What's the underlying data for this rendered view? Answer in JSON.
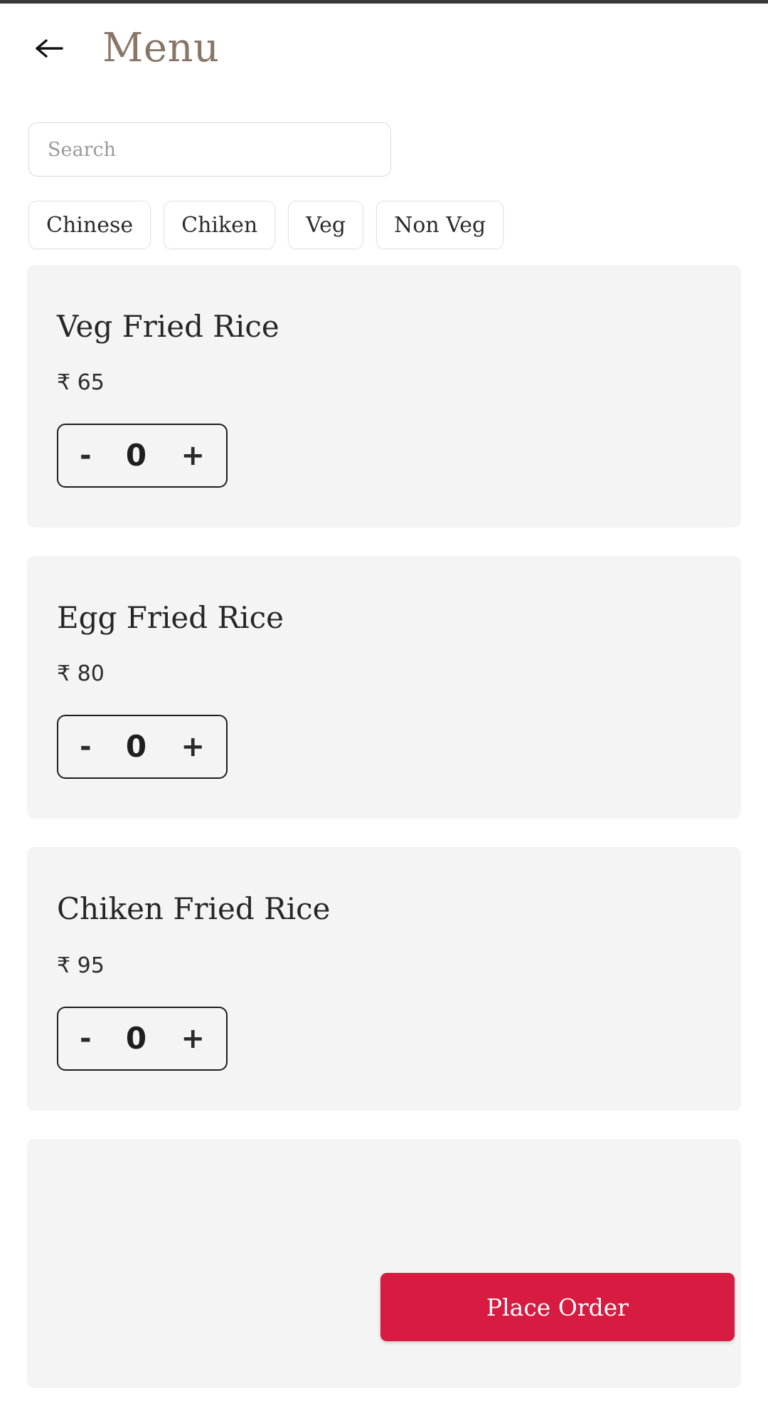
{
  "header": {
    "back_icon": "arrow-left-icon",
    "title": "Menu",
    "title_color": "#8a7668"
  },
  "search": {
    "placeholder": "Search",
    "value": ""
  },
  "filters": [
    {
      "label": "Chinese"
    },
    {
      "label": "Chiken"
    },
    {
      "label": "Veg"
    },
    {
      "label": "Non Veg"
    }
  ],
  "menu_items": [
    {
      "name": "Veg Fried Rice",
      "price": "₹ 65",
      "decrement_label": "-",
      "quantity": "0",
      "increment_label": "+"
    },
    {
      "name": "Egg Fried Rice",
      "price": "₹ 80",
      "decrement_label": "-",
      "quantity": "0",
      "increment_label": "+"
    },
    {
      "name": "Chiken Fried Rice",
      "price": "₹ 95",
      "decrement_label": "-",
      "quantity": "0",
      "increment_label": "+"
    },
    {
      "name": "",
      "price": "",
      "decrement_label": "",
      "quantity": "",
      "increment_label": ""
    }
  ],
  "place_order": {
    "label": "Place Order",
    "color": "#d81b40"
  }
}
